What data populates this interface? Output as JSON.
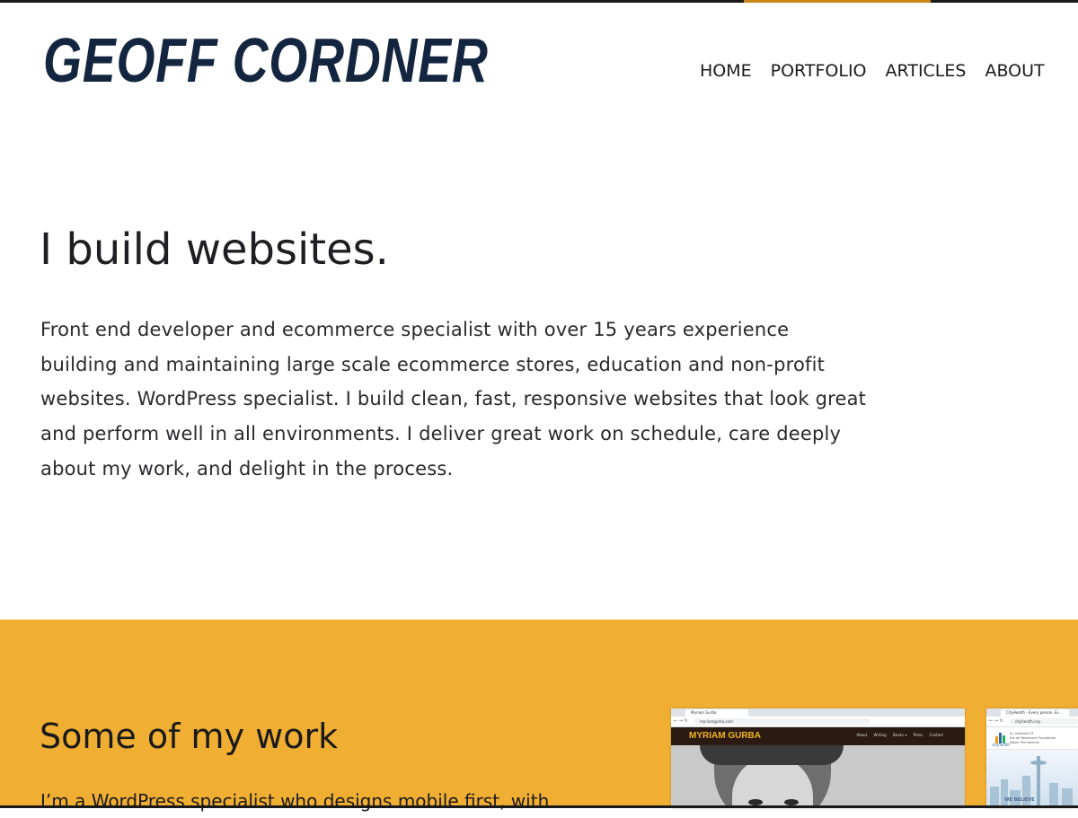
{
  "logo": {
    "text": "GEOFF CORDNER",
    "color": "#14263f"
  },
  "nav": {
    "items": [
      "HOME",
      "PORTFOLIO",
      "ARTICLES",
      "ABOUT"
    ]
  },
  "hero": {
    "title": "I build websites.",
    "description": "Front end developer and ecommerce specialist with over 15 years experience building and maintaining large scale ecommerce stores, education and non-profit websites. WordPress specialist. I build clean, fast, responsive websites that look great and perform well in all environments. I deliver great work on schedule, care deeply about my work, and delight in the process."
  },
  "work": {
    "title": "Some of my work",
    "text": "I’m a WordPress specialist who designs mobile first, with",
    "background": "#f0ae33"
  },
  "thumbnails": [
    {
      "tab_title": "Myriam Gurba",
      "url": "myriamgurba.com",
      "site_logo": "MYRIAM GURBA",
      "site_nav": [
        "About",
        "Writing",
        "Books ▾",
        "Press",
        "Contact"
      ]
    },
    {
      "tab_title": "CityHealth - Every person. Ev...",
      "url": "cityhealth.org",
      "logo_label": "cityhealth",
      "intro_lines": [
        "An Initiative Of",
        "the de Beaumont Foundation",
        "Kaiser Permanente"
      ],
      "banner_text": "WE BELIEVE"
    }
  ],
  "colors": {
    "accent": "#f0ae33",
    "top_accent": "#c9861a",
    "text": "#1f1f23"
  }
}
